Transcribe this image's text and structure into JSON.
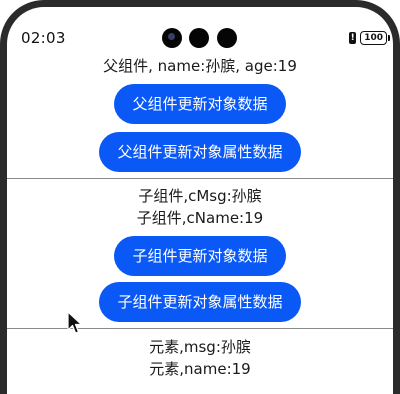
{
  "status_bar": {
    "time": "02:03",
    "alert_glyph": "!",
    "battery_level": "100"
  },
  "parent": {
    "info": "父组件, name:孙膑, age:19",
    "update_object_button": "父组件更新对象数据",
    "update_property_button": "父组件更新对象属性数据"
  },
  "child": {
    "msg_line": "子组件,cMsg:孙膑",
    "name_line": "子组件,cName:19",
    "update_object_button": "子组件更新对象数据",
    "update_property_button": "子组件更新对象属性数据"
  },
  "element": {
    "msg_line": "元素,msg:孙膑",
    "name_line": "元素,name:19"
  },
  "colors": {
    "button_background": "#0a59f7",
    "button_text": "#ffffff",
    "divider": "#8a8a8a"
  },
  "icons": {
    "cursor": "mouse-pointer-icon",
    "battery": "battery-icon",
    "alert": "alert-icon"
  }
}
